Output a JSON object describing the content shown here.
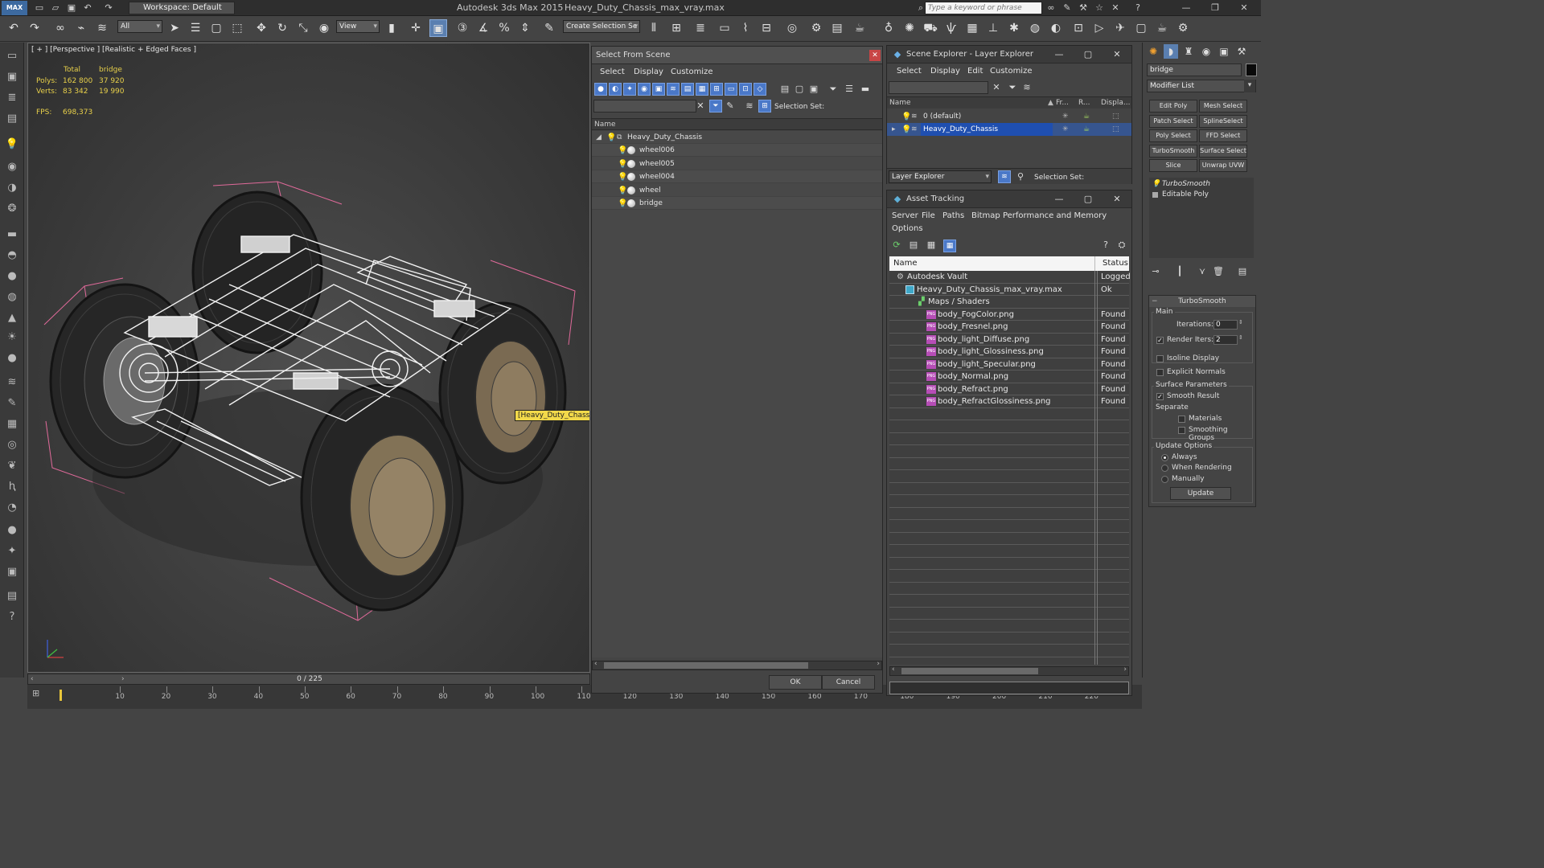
{
  "titlebar": {
    "logo": "MAX",
    "workspace": "Workspace: Default",
    "app_title": "Autodesk 3ds Max  2015",
    "file_title": "Heavy_Duty_Chassis_max_vray.max",
    "search_placeholder": "Type a keyword or phrase"
  },
  "toolbar": {
    "filter_dropdown": "All",
    "ref_coord_dropdown": "View",
    "selection_set_dropdown": "Create Selection Se"
  },
  "viewport": {
    "label": "[ + ] [Perspective ] [Realistic + Edged Faces ]",
    "stats": {
      "col_total": "Total",
      "col_selected": "bridge",
      "polys_label": "Polys:",
      "polys_total": "162 800",
      "polys_selected": "37 920",
      "verts_label": "Verts:",
      "verts_total": "83 342",
      "verts_selected": "19 990",
      "fps_label": "FPS:",
      "fps_value": "698,373"
    },
    "object_tag": "[Heavy_Duty_Chassis]"
  },
  "timeline": {
    "frame_display": "0 / 225",
    "ticks": [
      "10",
      "20",
      "30",
      "40",
      "50",
      "60",
      "70",
      "80",
      "90",
      "100",
      "110",
      "120",
      "130",
      "140",
      "150",
      "160",
      "170",
      "180",
      "190",
      "200",
      "210",
      "220"
    ]
  },
  "select_from_scene": {
    "title": "Select From Scene",
    "menus": [
      "Select",
      "Display",
      "Customize"
    ],
    "selection_set_label": "Selection Set:",
    "column_name": "Name",
    "tree": {
      "root": "Heavy_Duty_Chassis",
      "children": [
        "wheel006",
        "wheel005",
        "wheel004",
        "wheel",
        "bridge"
      ]
    },
    "ok_label": "OK",
    "cancel_label": "Cancel"
  },
  "scene_explorer": {
    "title": "Scene Explorer - Layer Explorer",
    "menus": [
      "Select",
      "Display",
      "Edit",
      "Customize"
    ],
    "columns": [
      "Name",
      "Fr...",
      "R...",
      "Displa..."
    ],
    "layers": [
      "0 (default)",
      "Heavy_Duty_Chassis"
    ],
    "bottom_dropdown": "Layer Explorer",
    "selection_set_label": "Selection Set:"
  },
  "asset_tracking": {
    "title": "Asset Tracking",
    "menus": [
      "Server",
      "File",
      "Paths",
      "Bitmap Performance and Memory"
    ],
    "menu_options": "Options",
    "col_name": "Name",
    "col_status": "Status",
    "rows": [
      {
        "name": "Autodesk Vault",
        "status": "Logged"
      },
      {
        "name": "Heavy_Duty_Chassis_max_vray.max",
        "status": "Ok"
      },
      {
        "name": "Maps / Shaders",
        "status": ""
      },
      {
        "name": "body_FogColor.png",
        "status": "Found"
      },
      {
        "name": "body_Fresnel.png",
        "status": "Found"
      },
      {
        "name": "body_light_Diffuse.png",
        "status": "Found"
      },
      {
        "name": "body_light_Glossiness.png",
        "status": "Found"
      },
      {
        "name": "body_light_Specular.png",
        "status": "Found"
      },
      {
        "name": "body_Normal.png",
        "status": "Found"
      },
      {
        "name": "body_Refract.png",
        "status": "Found"
      },
      {
        "name": "body_RefractGlossiness.png",
        "status": "Found"
      }
    ]
  },
  "command_panel": {
    "object_name": "bridge",
    "modifier_list": "Modifier List",
    "modifier_buttons": [
      "Edit Poly",
      "Mesh Select",
      "Patch Select",
      "SplineSelect",
      "Poly Select",
      "FFD Select",
      "TurboSmooth",
      "Surface Select",
      "Slice",
      "Unwrap UVW"
    ],
    "stack": [
      "TurboSmooth",
      "Editable Poly"
    ],
    "rollout": {
      "title": "TurboSmooth",
      "main_label": "Main",
      "iterations_label": "Iterations:",
      "iterations_value": "0",
      "render_iters_label": "Render Iters:",
      "render_iters_value": "2",
      "isoline_label": "Isoline Display",
      "explicit_normals_label": "Explicit Normals",
      "surface_params_label": "Surface Parameters",
      "smooth_result_label": "Smooth Result",
      "separate_label": "Separate",
      "materials_label": "Materials",
      "smoothing_groups_label": "Smoothing Groups",
      "update_options_label": "Update Options",
      "always_label": "Always",
      "when_rendering_label": "When Rendering",
      "manually_label": "Manually",
      "update_button": "Update"
    }
  }
}
